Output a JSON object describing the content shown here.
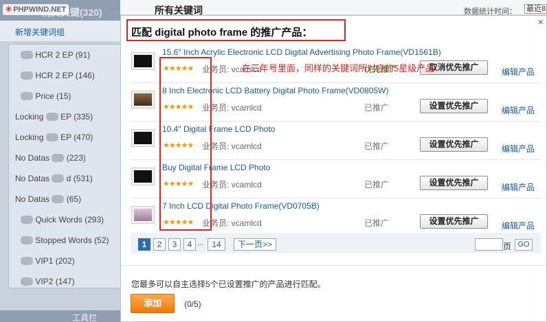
{
  "background": {
    "watermark": "PHPWIND.NET",
    "sidebar_header_partial": "精英关键(320)",
    "new_group_link": "新增关键词组",
    "groups": [
      {
        "prefix": "",
        "label": "HCR 2 EP (91)"
      },
      {
        "prefix": "",
        "label": "HCR 2 EP (146)"
      },
      {
        "prefix": "",
        "label": "Price (15)"
      },
      {
        "prefix": "Locking",
        "label": "EP (335)"
      },
      {
        "prefix": "Locking",
        "label": "EP (470)"
      },
      {
        "prefix": "No Datas",
        "label": "(223)"
      },
      {
        "prefix": "No Datas",
        "label": "d (531)"
      },
      {
        "prefix": "No Datas",
        "label": "(65)"
      },
      {
        "prefix": "",
        "label": "Quick Words (293)"
      },
      {
        "prefix": "",
        "label": "Stopped Words (52)"
      },
      {
        "prefix": "",
        "label": "VIP1 (202)"
      },
      {
        "prefix": "",
        "label": "VIP2 (147)"
      }
    ],
    "toolbar_partial": "工具栏",
    "page_heading_partial": "所有关键词",
    "stats_time_label": "数据统计时间：",
    "stats_select_value": "最近8"
  },
  "modal": {
    "close_glyph": "×",
    "title": "匹配 digital photo frame 的推广产品：",
    "annotation": "在三年号里面，同样的关键词所对应的5星级产品",
    "star_rating": 5,
    "products": [
      {
        "name": "15.6\" Inch Acrylic Electronic LCD Digital Advertising Photo Frame(VD1561B)",
        "staff": "业务员: vcamlcd",
        "status": "优先推广",
        "action": "取消优先推广",
        "edit": "编辑产品",
        "featured": true
      },
      {
        "name": "8 Inch Electronic LCD Battery Digital Photo Frame(VD0805W)",
        "staff": "业务员: vcamlcd",
        "status": "已推广",
        "action": "设置优先推广",
        "edit": "编辑产品",
        "featured": false
      },
      {
        "name": "10.4\" Digital Frame LCD Photo",
        "staff": "业务员: vcamlcd",
        "status": "已推广",
        "action": "设置优先推广",
        "edit": "编辑产品",
        "featured": false
      },
      {
        "name": "Buy Digital Frame LCD Photo",
        "staff": "业务员: vcamlcd",
        "status": "已推广",
        "action": "设置优先推广",
        "edit": "编辑产品",
        "featured": false
      },
      {
        "name": "7 Inch LCD Digital Photo Frame(VD0705B)",
        "staff": "业务员: vcamlcd",
        "status": "已推广",
        "action": "设置优先推广",
        "edit": "编辑产品",
        "featured": false
      }
    ],
    "pagination": {
      "pages": [
        "1",
        "2",
        "3",
        "4"
      ],
      "current": "1",
      "ellipsis": "...",
      "last": "14",
      "next": "下一页>>",
      "page_input_value": "",
      "page_label": "页",
      "go": "GO"
    },
    "note": "您最多可以自主选择5个已设置推广的产品进行匹配。",
    "add_button": "添加",
    "selected_count": "(0/5)"
  }
}
